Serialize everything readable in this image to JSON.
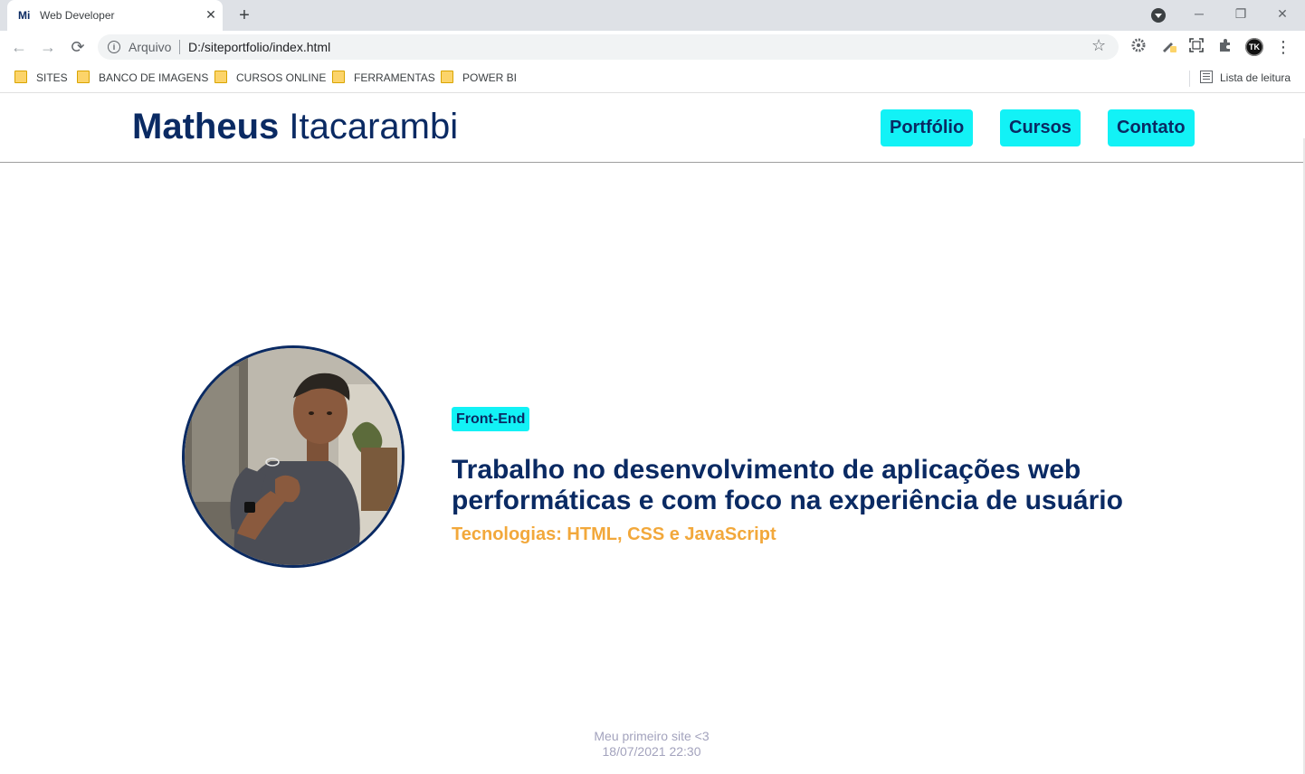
{
  "browser": {
    "tab": {
      "favicon": "Mi",
      "title": "Web Developer",
      "close_glyph": "✕"
    },
    "new_tab_glyph": "+",
    "window": {
      "minimize": "─",
      "restore": "❐",
      "close": "✕"
    },
    "toolbar": {
      "back": "←",
      "forward": "→",
      "reload": "⟳",
      "security_label": "Arquivo",
      "url": "D:/siteportfolio/index.html",
      "star": "☆",
      "extensions": [
        "gear-extension-icon",
        "pen-extension-icon",
        "screenshot-extension-icon",
        "puzzle-extension-icon"
      ],
      "profile_initials": "TK",
      "menu": "⋮"
    },
    "bookmarks": [
      "SITES",
      "BANCO DE IMAGENS",
      "CURSOS ONLINE",
      "FERRAMENTAS",
      "POWER BI"
    ],
    "reading_list": "Lista de leitura"
  },
  "site": {
    "logo": {
      "first": "Matheus",
      "last": "Itacarambi"
    },
    "nav": [
      "Portfólio",
      "Cursos",
      "Contato"
    ],
    "hero": {
      "badge": "Front-End",
      "headline": "Trabalho no desenvolvimento de aplicações web performáticas e com foco na experiência de usuário",
      "technologies": "Tecnologias: HTML, CSS e JavaScript"
    },
    "footer": {
      "line1": "Meu primeiro site <3",
      "line2": "18/07/2021 22:30"
    }
  },
  "colors": {
    "brand_navy": "#0a2a63",
    "accent_cyan": "#12f2f6",
    "accent_orange": "#f2a83b",
    "footer_gray": "#a3a3bd"
  }
}
